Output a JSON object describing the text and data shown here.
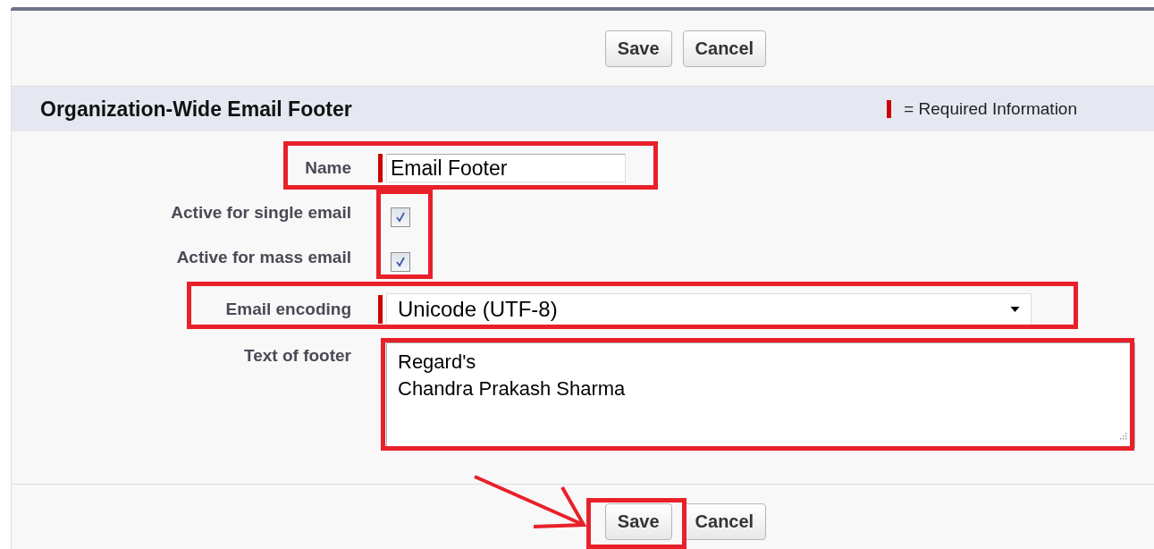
{
  "top_buttons": [
    {
      "label": "Save"
    },
    {
      "label": "Cancel"
    }
  ],
  "section": {
    "title": "Organization-Wide Email Footer",
    "legend": "= Required Information"
  },
  "fields": [
    {
      "kind": "text",
      "label": "Name",
      "required": true,
      "value": "Email Footer"
    },
    {
      "kind": "checkbox",
      "label": "Active for single email",
      "checked": true
    },
    {
      "kind": "checkbox",
      "label": "Active for mass email",
      "checked": true
    },
    {
      "kind": "select",
      "label": "Email encoding",
      "required": true,
      "value": "Unicode (UTF-8)"
    },
    {
      "kind": "textarea",
      "label": "Text of footer",
      "required": false,
      "lines": [
        "Regard's",
        "Chandra Prakash Sharma"
      ]
    }
  ],
  "bottom_buttons": [
    {
      "label": "Save"
    },
    {
      "label": "Cancel"
    }
  ]
}
